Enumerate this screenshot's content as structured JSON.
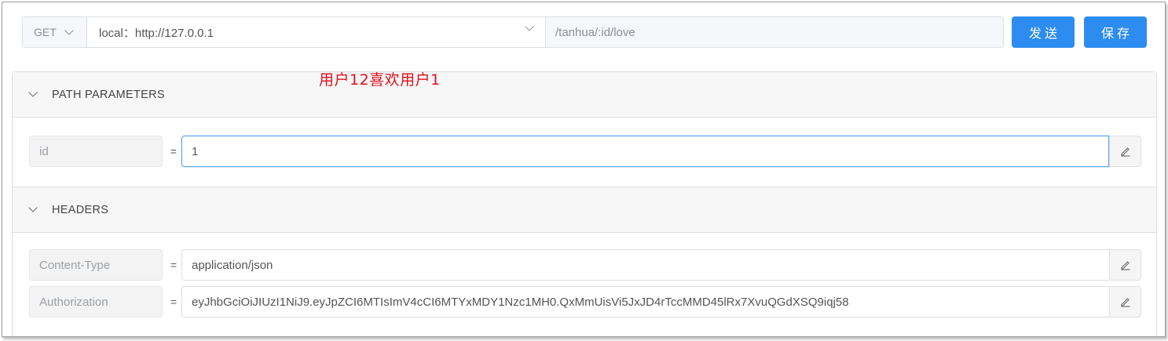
{
  "request": {
    "method": "GET",
    "environment": "local：http://127.0.0.1",
    "path": "/tanhua/:id/love"
  },
  "buttons": {
    "send": "发送",
    "save": "保存"
  },
  "annotation": "用户12喜欢用户1",
  "path_parameters": {
    "title": "PATH PARAMETERS",
    "rows": [
      {
        "key": "id",
        "value": "1"
      }
    ]
  },
  "headers": {
    "title": "HEADERS",
    "rows": [
      {
        "key": "Content-Type",
        "value": "application/json"
      },
      {
        "key": "Authorization",
        "value": "eyJhbGciOiJIUzI1NiJ9.eyJpZCI6MTIsImV4cCI6MTYxMDY1Nzc1MH0.QxMmUisVi5JxJD4rTccMMD45lRx7XvuQGdXSQ9iqj58"
      }
    ]
  },
  "separator": "=",
  "icons": {
    "method_dropdown": "chevron-down-icon",
    "env_dropdown": "chevron-down-icon",
    "collapse": "chevron-down-icon",
    "edit": "pencil-icon"
  },
  "colors": {
    "primary": "#2d8cf0",
    "annotation": "#e0101a",
    "focus_border": "#57a3f3"
  }
}
